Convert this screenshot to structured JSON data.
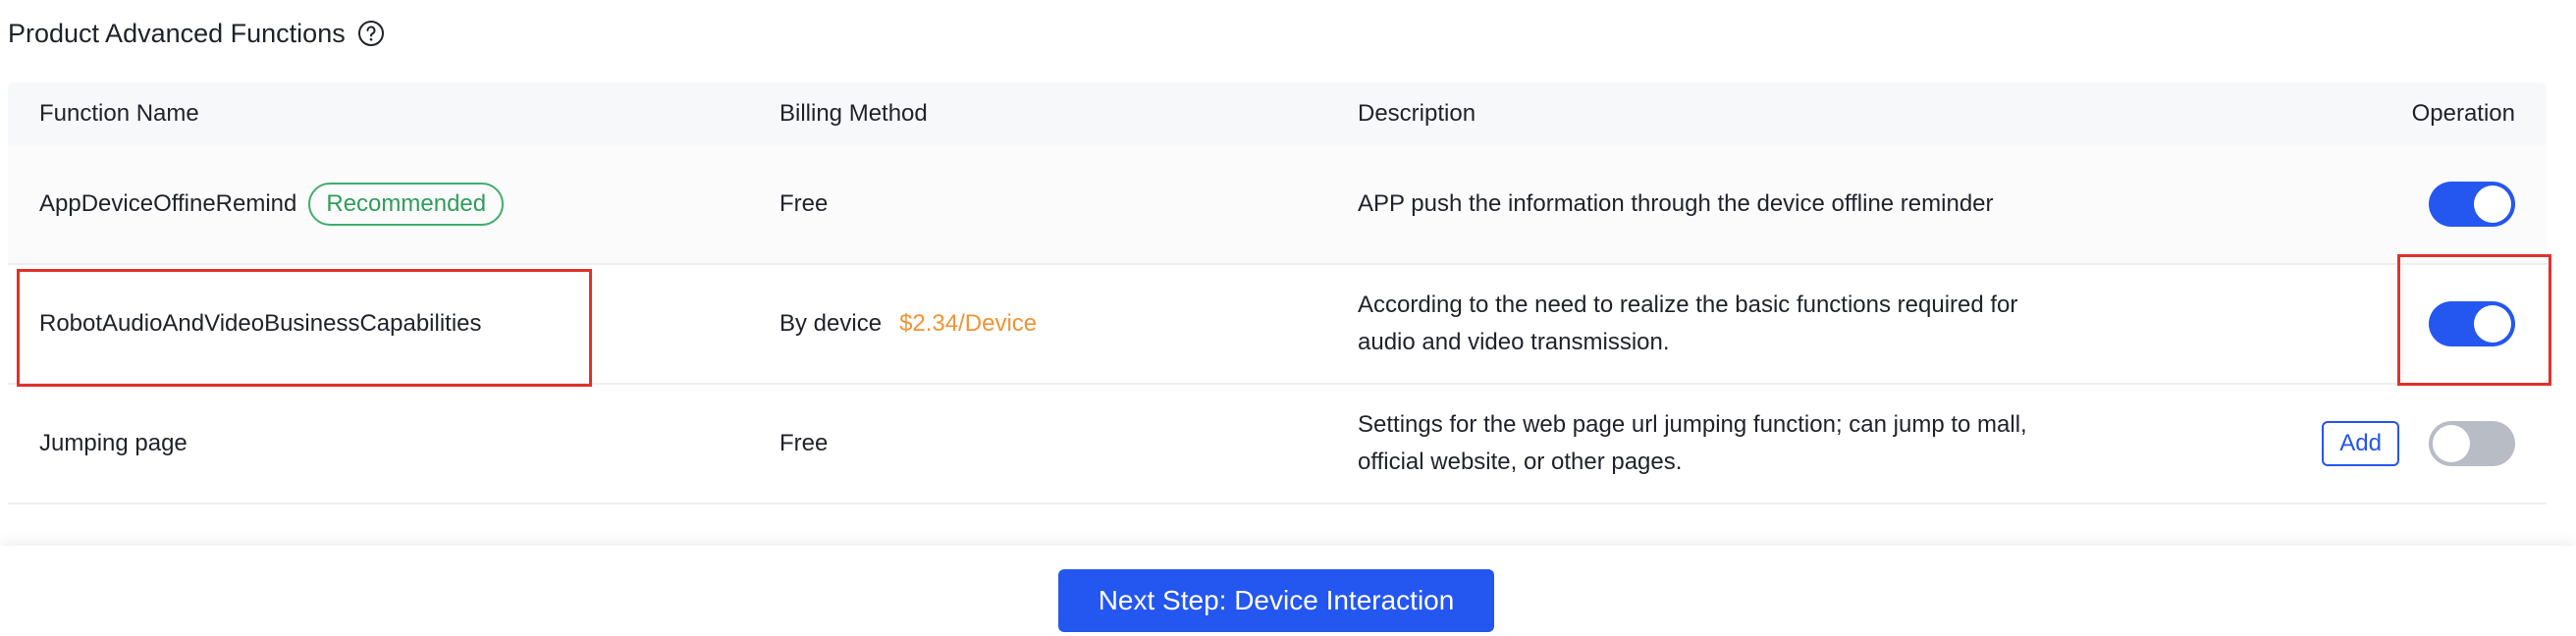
{
  "section": {
    "title": "Product Advanced Functions",
    "help_icon": "question-circle-icon"
  },
  "table": {
    "headers": {
      "name": "Function Name",
      "billing": "Billing Method",
      "description": "Description",
      "operation": "Operation"
    },
    "rows": [
      {
        "name": "AppDeviceOffineRemind",
        "badge": "Recommended",
        "billing": "Free",
        "price": "",
        "description": "APP push the information through the device offline reminder",
        "enabled": true
      },
      {
        "name": "RobotAudioAndVideoBusinessCapabilities",
        "badge": "",
        "billing": "By device",
        "price": "$2.34/Device",
        "description": "According to the need to realize the basic functions required for audio and video transmission.",
        "enabled": true
      },
      {
        "name": "Jumping page",
        "badge": "",
        "billing": "Free",
        "price": "",
        "description": "Settings for the web page url jumping function; can jump to mall, official website, or other pages.",
        "add_label": "Add",
        "enabled": false
      }
    ]
  },
  "footer": {
    "next_step_label": "Next Step: Device Interaction"
  },
  "colors": {
    "primary": "#2456f0",
    "recommended": "#2f9d5c",
    "price": "#f09433",
    "highlight": "#e0322a",
    "toggle_off": "#b8bcc4"
  }
}
